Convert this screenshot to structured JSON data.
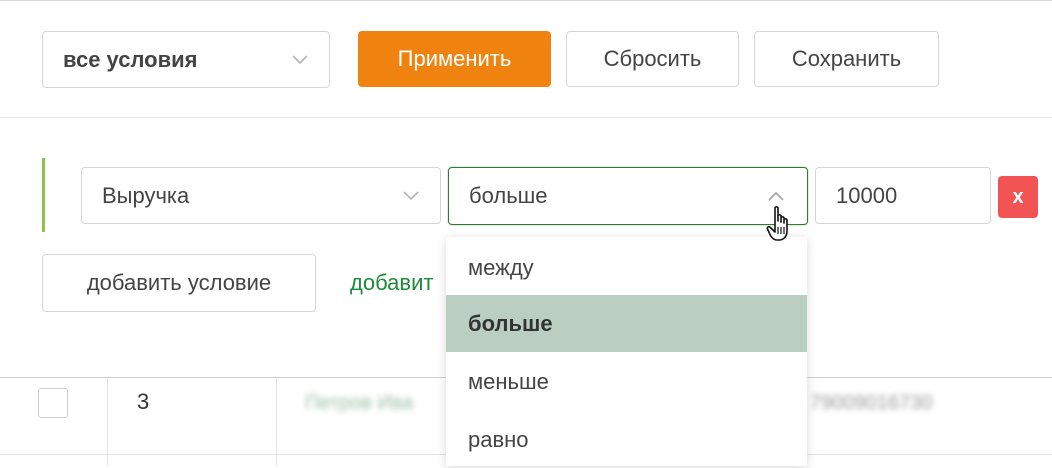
{
  "toolbar": {
    "condition_mode_value": "все условия",
    "apply_label": "Применить",
    "reset_label": "Сбросить",
    "save_label": "Сохранить"
  },
  "condition": {
    "field_value": "Выручка",
    "operator_value": "больше",
    "amount_value": "10000",
    "remove_label": "x"
  },
  "actions": {
    "add_condition_label": "добавить условие",
    "add_group_label": "добавит"
  },
  "operator_menu": {
    "options": [
      "между",
      "больше",
      "меньше",
      "равно"
    ],
    "selected": "больше"
  },
  "table": {
    "row": {
      "number": "3",
      "name_blurred": "Петров Ива",
      "phone_blurred": "79009016730"
    }
  },
  "colors": {
    "primary": "#f0830f",
    "accent_green": "#1f8a3a",
    "danger": "#f25454",
    "selected_option_bg": "#bacfc1"
  }
}
